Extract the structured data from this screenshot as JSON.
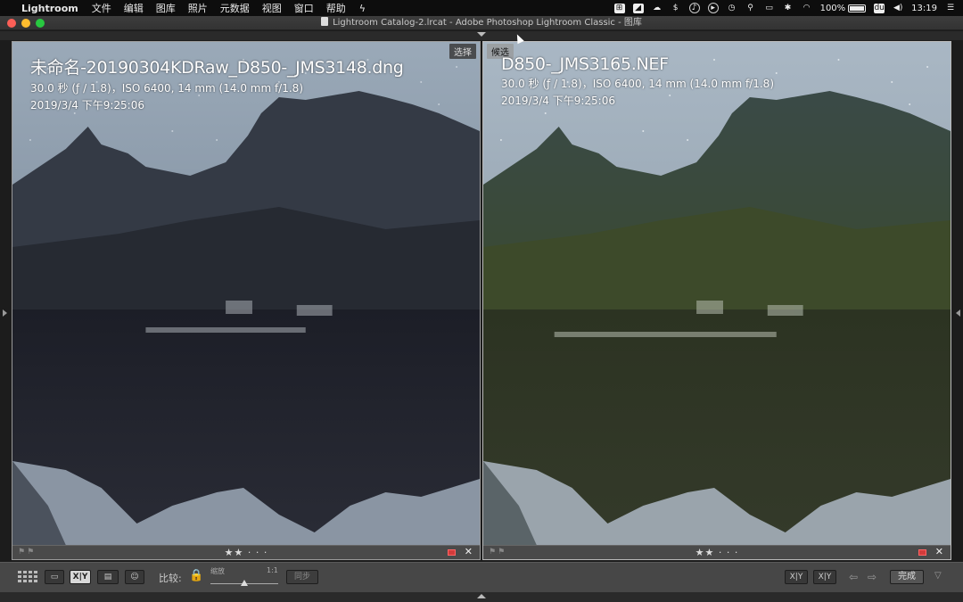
{
  "menubar": {
    "app_name": "Lightroom",
    "menus": [
      "文件",
      "编辑",
      "图库",
      "照片",
      "元数据",
      "视图",
      "窗口",
      "帮助"
    ],
    "tray": {
      "battery_percent": "100%",
      "clock": "13:19"
    }
  },
  "window": {
    "title": "Lightroom Catalog-2.lrcat - Adobe Photoshop Lightroom Classic - 图库"
  },
  "compare": {
    "left": {
      "tag": "选择",
      "filename": "未命名-20190304KDRaw_D850-_JMS3148.dng",
      "exposure": "30.0 秒 (ƒ / 1.8)，ISO 6400, 14 mm (14.0 mm f/1.8)",
      "datetime": "2019/3/4 下午9:25:06",
      "rating_stars": "★★",
      "rating_dots": "· · ·"
    },
    "right": {
      "tag": "候选",
      "filename": "D850-_JMS3165.NEF",
      "exposure": "30.0 秒 (ƒ / 1.8)，ISO 6400, 14 mm (14.0 mm f/1.8)",
      "datetime": "2019/3/4 下午9:25:06",
      "rating_stars": "★★",
      "rating_dots": "· · ·"
    }
  },
  "toolbar": {
    "compare_label": "比较:",
    "zoom_label": "缩放",
    "zoom_ratio": "1:1",
    "sync_button": "同步",
    "xy_label": "X|Y",
    "swap_label": "X|Y",
    "done_button": "完成",
    "zoom_slider_value": 0.5
  },
  "icons": {
    "grid": "grid-view-icon",
    "loupe": "loupe-view-icon",
    "compare": "compare-view-icon",
    "survey": "survey-view-icon",
    "people": "people-view-icon",
    "lock": "lock-icon"
  },
  "colors": {
    "close": "#fc5f57",
    "minimize": "#fdbc2e",
    "maximize": "#28c840",
    "reject_flag": "#d23b3b"
  }
}
